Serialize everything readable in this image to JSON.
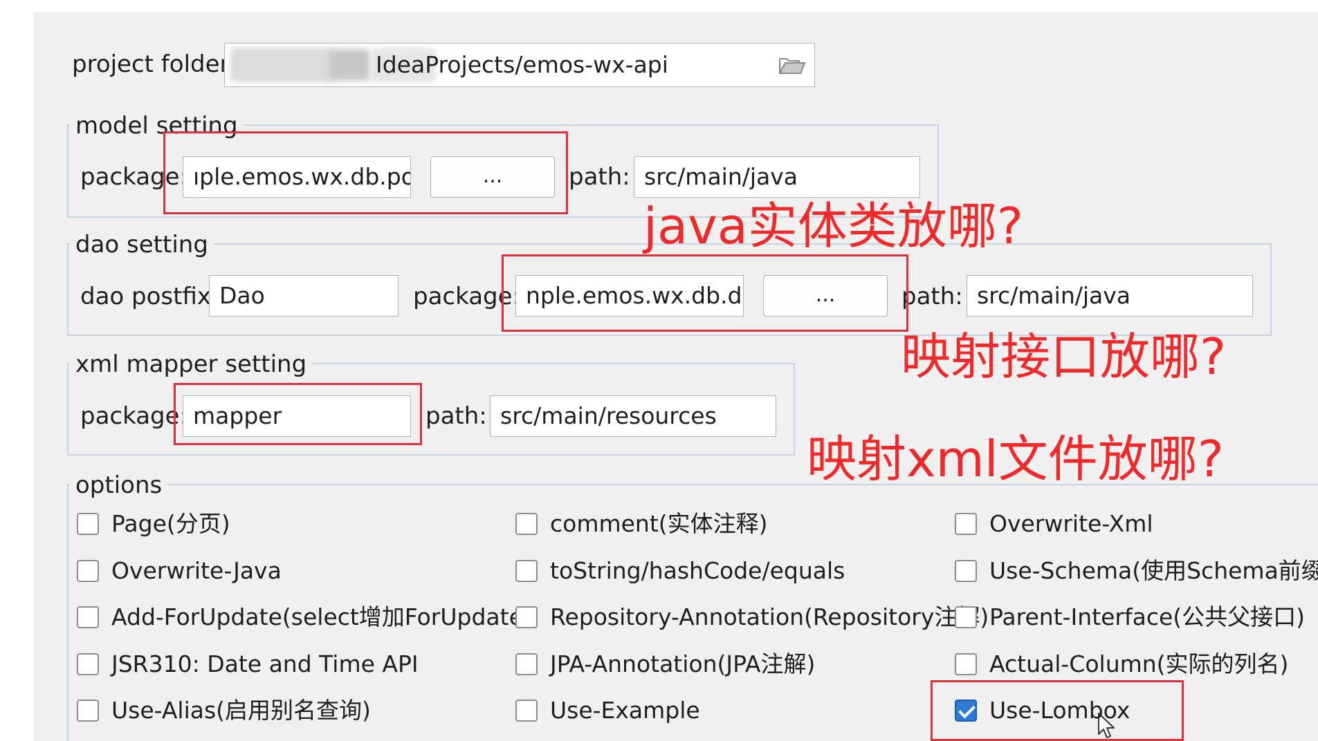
{
  "project": {
    "label": "project folder:",
    "path_value": "IdeaProjects/emos-wx-api",
    "browse_icon": "folder-open-icon"
  },
  "model": {
    "legend": "model setting",
    "package_label": "package:",
    "package_value": "ıple.emos.wx.db.pojo",
    "browse_label": "...",
    "path_label": "path:",
    "path_value": "src/main/java"
  },
  "dao": {
    "legend": "dao setting",
    "postfix_label": "dao postfix:",
    "postfix_value": "Dao",
    "package_label": "package:",
    "package_value": "nple.emos.wx.db.dao",
    "browse_label": "...",
    "path_label": "path:",
    "path_value": "src/main/java"
  },
  "xml": {
    "legend": "xml mapper setting",
    "package_label": "package:",
    "package_value": "mapper",
    "path_label": "path:",
    "path_value": "src/main/resources"
  },
  "options": {
    "legend": "options",
    "items": [
      {
        "label": "Page(分页)",
        "checked": false
      },
      {
        "label": "comment(实体注释)",
        "checked": false
      },
      {
        "label": "Overwrite-Xml",
        "checked": false
      },
      {
        "label": "Overwrite-Java",
        "checked": false
      },
      {
        "label": "toString/hashCode/equals",
        "checked": false
      },
      {
        "label": "Use-Schema(使用Schema前缀)",
        "checked": false
      },
      {
        "label": "Add-ForUpdate(select增加ForUpdate)",
        "checked": false
      },
      {
        "label": "Repository-Annotation(Repository注解)",
        "checked": false
      },
      {
        "label": "Parent-Interface(公共父接口)",
        "checked": false
      },
      {
        "label": "JSR310: Date and Time API",
        "checked": false
      },
      {
        "label": "JPA-Annotation(JPA注解)",
        "checked": false
      },
      {
        "label": "Actual-Column(实际的列名)",
        "checked": false
      },
      {
        "label": "Use-Alias(启用别名查询)",
        "checked": false
      },
      {
        "label": "Use-Example",
        "checked": false
      },
      {
        "label": "Use-Lombox",
        "checked": true
      }
    ]
  },
  "annotations": {
    "note1": "java实体类放哪?",
    "note2": "映射接口放哪?",
    "note3": "映射xml文件放哪?",
    "color": "#ee2a2a"
  },
  "colors": {
    "panel_bg": "#f0f0f0",
    "group_border": "#c5d3e3",
    "checkbox_checked": "#2f7ad6"
  }
}
